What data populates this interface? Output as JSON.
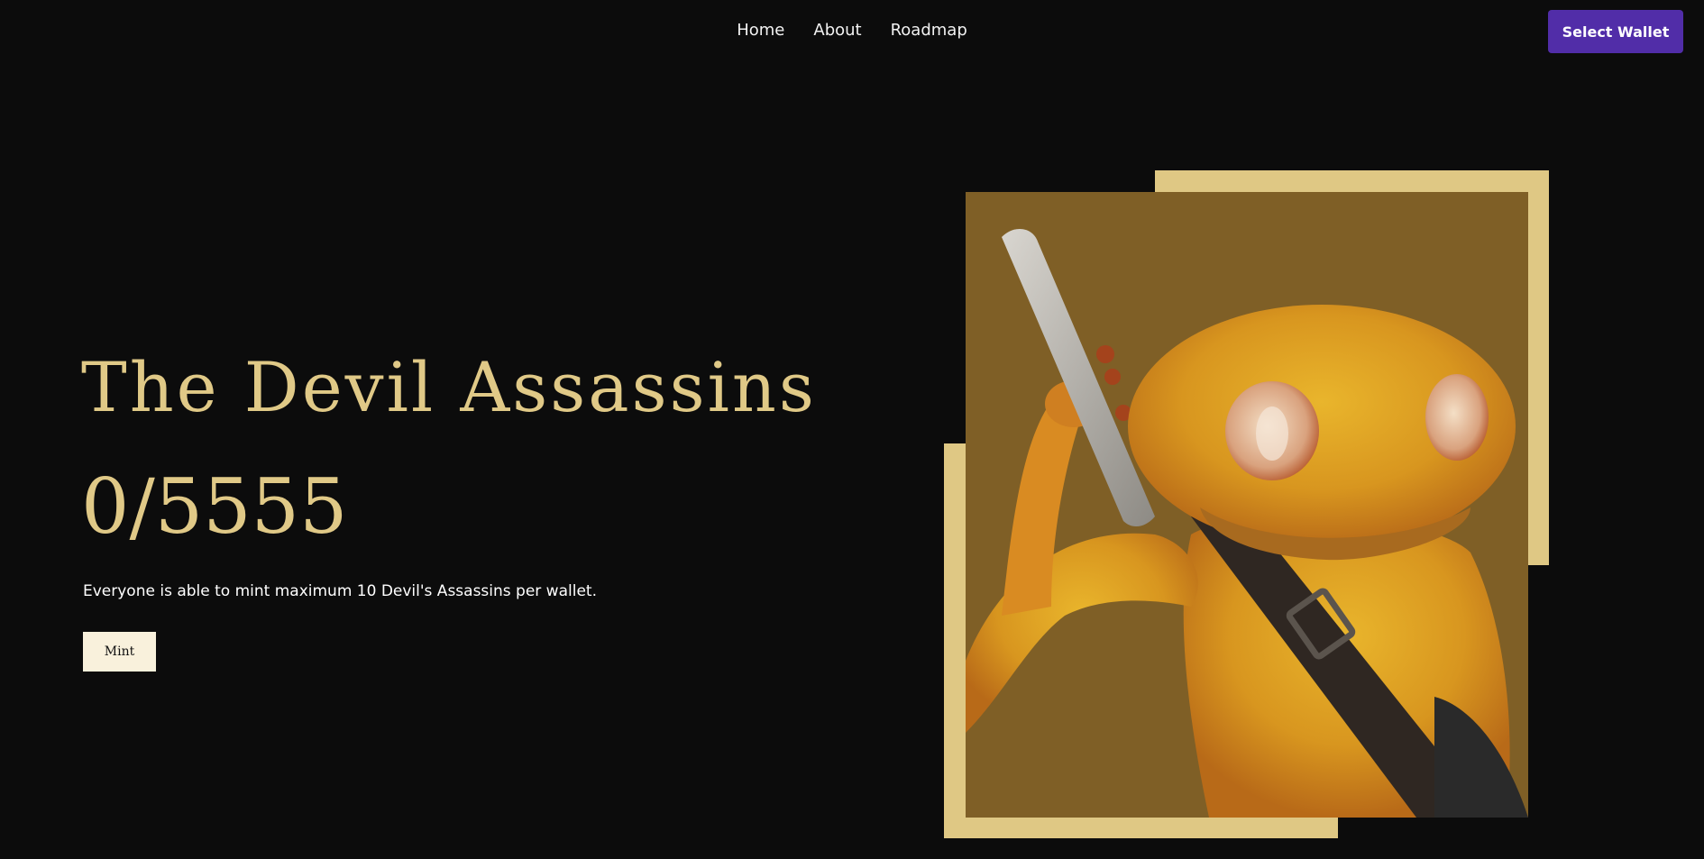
{
  "nav": {
    "items": [
      {
        "label": "Home"
      },
      {
        "label": "About"
      },
      {
        "label": "Roadmap"
      }
    ]
  },
  "wallet": {
    "label": "Select Wallet",
    "color": "#512da8"
  },
  "hero": {
    "title": "The Devil Assassins",
    "count": "0/5555",
    "description": "Everyone is able to mint maximum 10 Devil's Assassins per wallet.",
    "mint_label": "Mint"
  },
  "artwork": {
    "icon": "frog-assassin-illustration",
    "background_color": "#7f5f26",
    "frame_color": "#dfc884"
  },
  "colors": {
    "page_background": "#0c0c0c",
    "accent_gold": "#e0c987",
    "mint_button": "#f9f1dc"
  }
}
